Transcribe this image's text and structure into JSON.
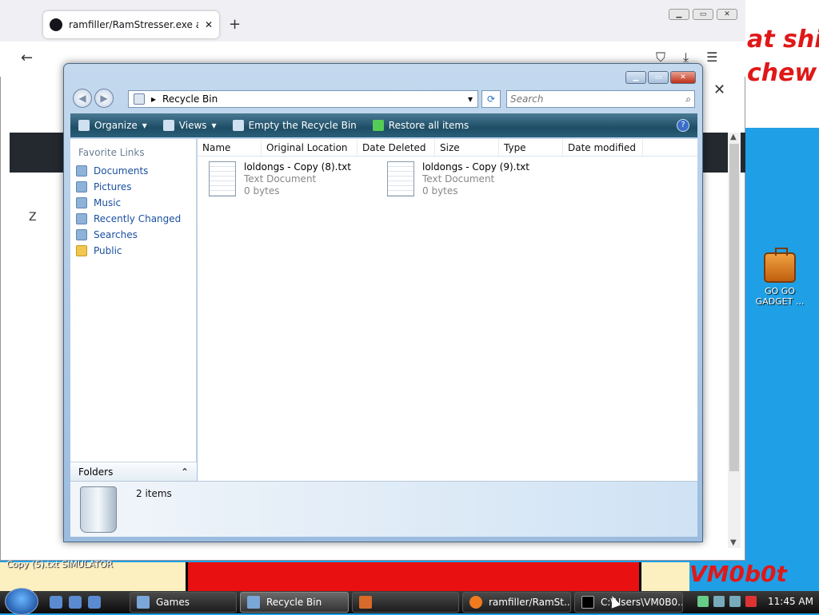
{
  "desktop": {
    "wall_text_1": "at shi",
    "wall_text_2": "chew",
    "signature": "VM0b0t",
    "gadget_icon_label": "GO GO GADGET ...",
    "file_label": "Copy (5).txt    SIMULATOR"
  },
  "firefox": {
    "tab_title": "ramfiller/RamStresser.exe at ma",
    "tab_close": "✕",
    "new_tab": "+",
    "min": "▁",
    "max": "▭",
    "close": "✕",
    "back": "←",
    "notif_close": "✕",
    "gh_left_text": "Z"
  },
  "explorer": {
    "address": "Recycle Bin",
    "search_placeholder": "Search",
    "toolbar": {
      "organize": "Organize",
      "views": "Views",
      "empty": "Empty the Recycle Bin",
      "restore": "Restore all items",
      "help": "?"
    },
    "nav": {
      "header": "Favorite Links",
      "links": [
        "Documents",
        "Pictures",
        "Music",
        "Recently Changed",
        "Searches",
        "Public"
      ],
      "folders": "Folders"
    },
    "columns": [
      "Name",
      "Original Location",
      "Date Deleted",
      "Size",
      "Type",
      "Date modified"
    ],
    "files": [
      {
        "name": "loldongs - Copy (8).txt",
        "type": "Text Document",
        "size": "0 bytes"
      },
      {
        "name": "loldongs - Copy (9).txt",
        "type": "Text Document",
        "size": "0 bytes"
      }
    ],
    "status": "2 items"
  },
  "taskbar": {
    "tasks": [
      "Games",
      "Recycle Bin",
      "",
      "ramfiller/RamSt...",
      "C:\\Users\\VM0B0..."
    ],
    "clock": "11:45 AM"
  }
}
